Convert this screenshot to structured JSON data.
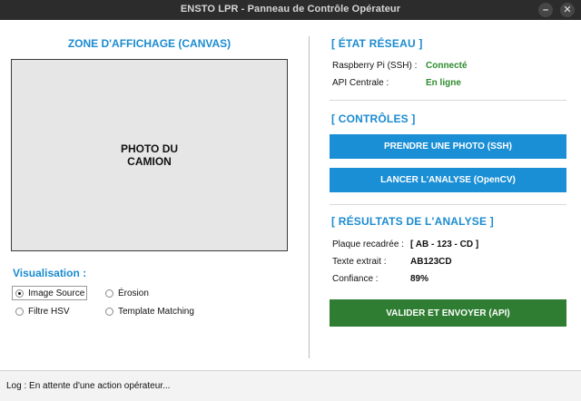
{
  "window": {
    "title": "ENSTO LPR - Panneau de Contrôle Opérateur",
    "minimize_glyph": "–",
    "close_glyph": "✕"
  },
  "canvas": {
    "title": "ZONE D'AFFICHAGE (CANVAS)",
    "placeholder_line1": "PHOTO DU",
    "placeholder_line2": "CAMION"
  },
  "visualisation": {
    "title": "Visualisation :",
    "selected": "Image Source",
    "options": [
      "Image Source",
      "Érosion",
      "Filtre HSV",
      "Template Matching"
    ]
  },
  "network": {
    "title": "[ ÉTAT RÉSEAU ]",
    "rows": [
      {
        "label": "Raspberry Pi (SSH) :",
        "value": "Connecté"
      },
      {
        "label": "API Centrale :",
        "value": "En ligne"
      }
    ],
    "value_color": "#2e8b2e"
  },
  "controls": {
    "title": "[ CONTRÔLES ]",
    "take_photo_label": "PRENDRE UNE PHOTO (SSH)",
    "run_analysis_label": "LANCER L'ANALYSE (OpenCV)"
  },
  "results": {
    "title": "[ RÉSULTATS DE L'ANALYSE ]",
    "rows": [
      {
        "label": "Plaque recadrée :",
        "value": "[ AB - 123 - CD ]"
      },
      {
        "label": "Texte extrait :",
        "value": "AB123CD"
      },
      {
        "label": "Confiance :",
        "value": "89%"
      }
    ],
    "validate_label": "VALIDER ET ENVOYER (API)"
  },
  "status": {
    "log_text": "Log : En attente d'une action opérateur..."
  },
  "colors": {
    "accent": "#1b8bd0",
    "button_blue": "#1a8fd6",
    "button_green": "#2e7d32"
  }
}
